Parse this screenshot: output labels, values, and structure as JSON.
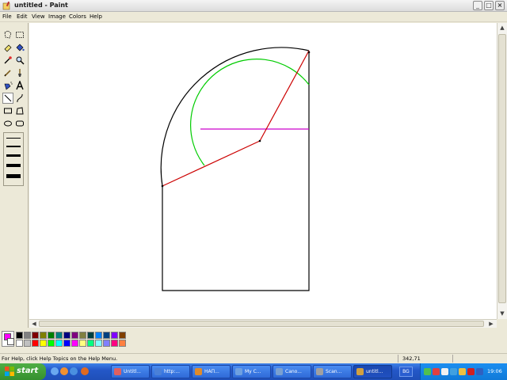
{
  "window": {
    "title": "untitled - Paint"
  },
  "menu": [
    "File",
    "Edit",
    "View",
    "Image",
    "Colors",
    "Help"
  ],
  "tools": [
    "free-form-select",
    "select",
    "eraser",
    "fill-with-color",
    "pick-color",
    "magnifier",
    "pencil",
    "brush",
    "airbrush",
    "text",
    "line",
    "curve",
    "rectangle",
    "polygon",
    "ellipse",
    "rounded-rectangle"
  ],
  "active_tool": "line",
  "colors": {
    "foreground": "#ff00ff",
    "background": "#ffffff",
    "palette": [
      "#000000",
      "#808080",
      "#800000",
      "#808000",
      "#008000",
      "#008080",
      "#000080",
      "#800080",
      "#808040",
      "#004040",
      "#0080ff",
      "#004080",
      "#8000ff",
      "#804000",
      "#ffffff",
      "#c0c0c0",
      "#ff0000",
      "#ffff00",
      "#00ff00",
      "#00ffff",
      "#0000ff",
      "#ff00ff",
      "#ffff80",
      "#00ff80",
      "#80ffff",
      "#8080ff",
      "#ff0080",
      "#ff8040"
    ],
    "drawing_black": "#000000",
    "drawing_red": "#cc0000",
    "drawing_green": "#00cc00",
    "drawing_magenta": "#cc00cc"
  },
  "status": {
    "help": "For Help, click Help Topics on the Help Menu.",
    "coords": "342,71"
  },
  "taskbar": {
    "start": "start",
    "tasks": [
      {
        "label": "Untitl...",
        "icon_color": "#e06060"
      },
      {
        "label": "http:...",
        "icon_color": "#4a80d8"
      },
      {
        "label": "НАП...",
        "icon_color": "#e08a2a"
      },
      {
        "label": "My C...",
        "icon_color": "#6ea0e0"
      },
      {
        "label": "Cano...",
        "icon_color": "#7aa0d0"
      },
      {
        "label": "Scan...",
        "icon_color": "#a0a0a0"
      },
      {
        "label": "untitl...",
        "icon_color": "#d0a040",
        "active": true
      }
    ],
    "language": "BG",
    "clock": "19:06"
  }
}
